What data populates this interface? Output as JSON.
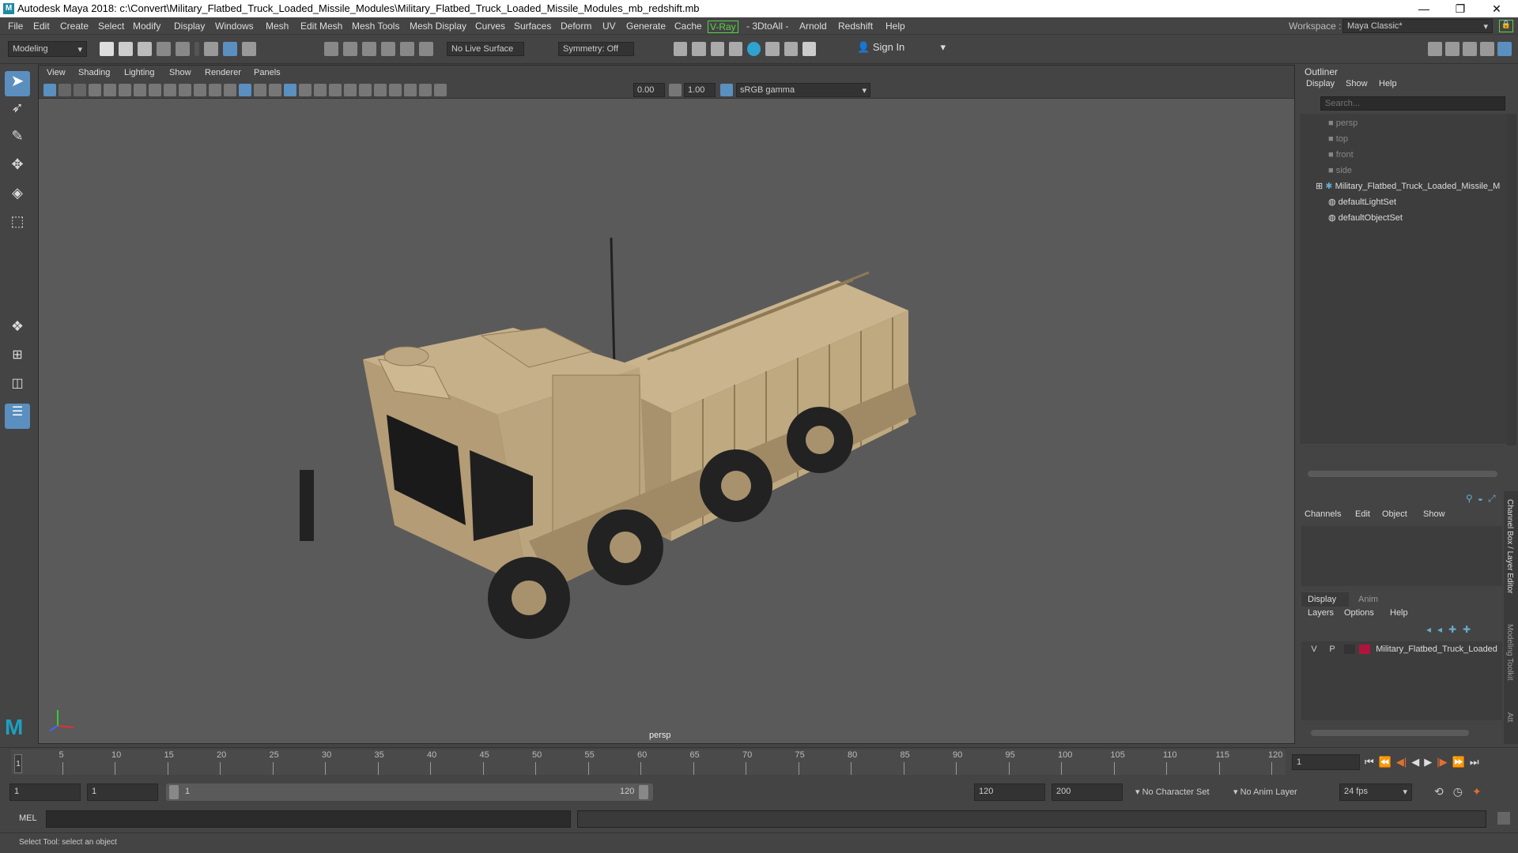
{
  "window": {
    "title": "Autodesk Maya 2018: c:\\Convert\\Military_Flatbed_Truck_Loaded_Missile_Modules\\Military_Flatbed_Truck_Loaded_Missile_Modules_mb_redshift.mb",
    "minimize": "—",
    "maximize": "❐",
    "close": "✕"
  },
  "menus": [
    "File",
    "Edit",
    "Create",
    "Select",
    "Modify",
    "Display",
    "Windows",
    "Mesh",
    "Edit Mesh",
    "Mesh Tools",
    "Mesh Display",
    "Curves",
    "Surfaces",
    "Deform",
    "UV",
    "Generate",
    "Cache",
    "V-Ray",
    "- 3DtoAll -",
    "Arnold",
    "Redshift",
    "Help"
  ],
  "workspace": {
    "label": "Workspace :",
    "value": "Maya Classic*"
  },
  "status_line": {
    "mode": "Modeling",
    "live_surface": "No Live Surface",
    "symmetry": "Symmetry: Off",
    "sign_in": "Sign In"
  },
  "viewport_menu": [
    "View",
    "Shading",
    "Lighting",
    "Show",
    "Renderer",
    "Panels"
  ],
  "viewport_toolbar": {
    "exposure": "0.00",
    "gamma": "1.00",
    "color_space": "sRGB gamma"
  },
  "viewport": {
    "camera_label": "persp",
    "body_color": "#b9a27c",
    "accent_color": "#1e8aa3"
  },
  "outliner": {
    "title": "Outliner",
    "menus": [
      "Display",
      "Show",
      "Help"
    ],
    "search_placeholder": "Search...",
    "items": [
      {
        "label": "persp",
        "icon": "camera-icon",
        "dim": true
      },
      {
        "label": "top",
        "icon": "camera-icon",
        "dim": true
      },
      {
        "label": "front",
        "icon": "camera-icon",
        "dim": true
      },
      {
        "label": "side",
        "icon": "camera-icon",
        "dim": true
      },
      {
        "label": "Military_Flatbed_Truck_Loaded_Missile_M",
        "icon": "group-icon",
        "dim": false
      },
      {
        "label": "defaultLightSet",
        "icon": "set-icon",
        "dim": false
      },
      {
        "label": "defaultObjectSet",
        "icon": "set-icon",
        "dim": false
      }
    ]
  },
  "channel_box": {
    "menus": [
      "Channels",
      "Edit",
      "Object",
      "Show"
    ],
    "side_tab_1": "Channel Box / Layer Editor",
    "side_tab_2": "Modeling Toolkit",
    "side_tab_3": "Att"
  },
  "layer_editor": {
    "tabs": [
      "Display",
      "Anim"
    ],
    "menus": [
      "Layers",
      "Options",
      "Help"
    ],
    "layer": {
      "v": "V",
      "p": "P",
      "name": "Military_Flatbed_Truck_Loaded",
      "color": "#b0143c"
    }
  },
  "timeline": {
    "ticks": [
      "5",
      "10",
      "15",
      "20",
      "25",
      "30",
      "35",
      "40",
      "45",
      "50",
      "55",
      "60",
      "65",
      "70",
      "75",
      "80",
      "85",
      "90",
      "95",
      "100",
      "105",
      "110",
      "115",
      "120"
    ],
    "current_marker": "1",
    "current_frame": "1"
  },
  "range": {
    "start": "1",
    "playback_start": "1",
    "slider_start": "1",
    "slider_end": "120",
    "playback_end": "120",
    "end": "200",
    "character_set": "No Character Set",
    "anim_layer": "No Anim Layer",
    "fps": "24 fps"
  },
  "command_line": {
    "label": "MEL"
  },
  "help_line": {
    "text": "Select Tool: select an object"
  }
}
